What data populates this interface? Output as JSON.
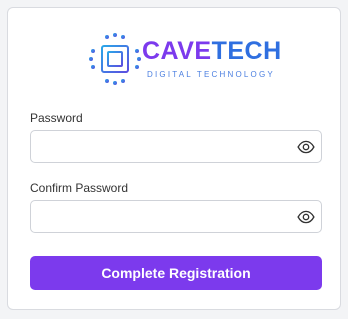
{
  "brand": {
    "name_part1": "CAVE",
    "name_part2": "TECH",
    "tagline": "DIGITAL TECHNOLOGY",
    "colors": {
      "primary_purple": "#7c3aed",
      "secondary_blue": "#2f6fe0",
      "chip_gradient_start": "#2aa6e8",
      "chip_gradient_end": "#5b4ee0"
    },
    "icon": "circuit-chip-icon"
  },
  "form": {
    "password": {
      "label": "Password",
      "value": "",
      "placeholder": "",
      "toggle_icon": "eye-icon"
    },
    "confirm_password": {
      "label": "Confirm Password",
      "value": "",
      "placeholder": "",
      "toggle_icon": "eye-icon"
    },
    "submit_label": "Complete Registration",
    "submit_color": "#7c3aed"
  }
}
